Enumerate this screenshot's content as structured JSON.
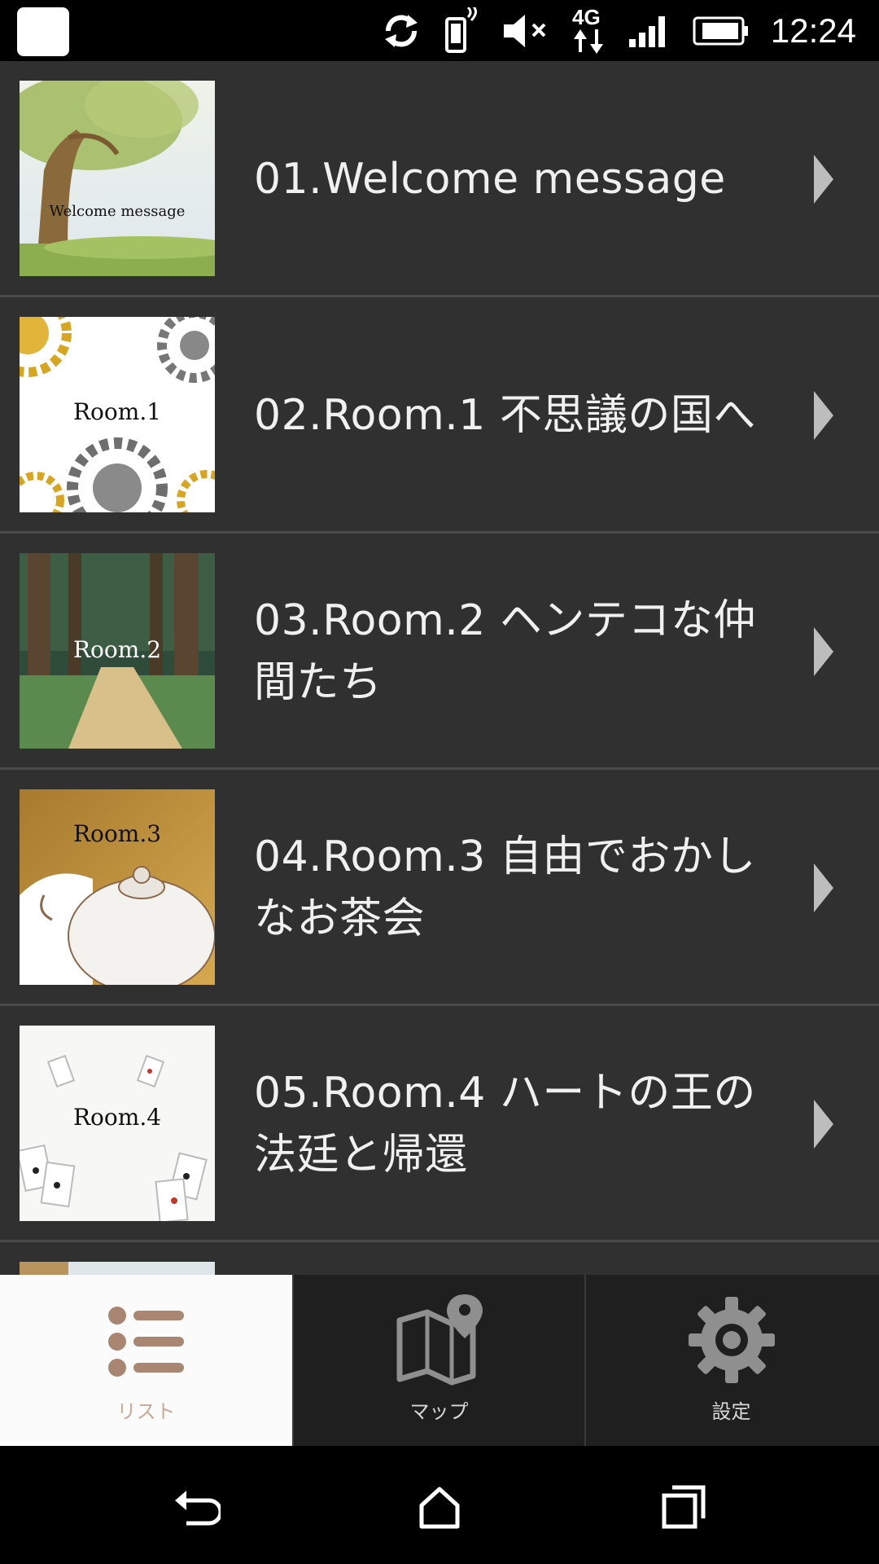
{
  "status_bar": {
    "time": "12:24",
    "icons": [
      "app-icon",
      "sync-icon",
      "vibrate-icon",
      "mute-icon",
      "4g-data-icon",
      "signal-icon",
      "battery-icon"
    ]
  },
  "list": {
    "items": [
      {
        "title_line1": "01.Welcome message",
        "title_line2": "",
        "thumb_label": "Welcome message"
      },
      {
        "title_line1": "02.Room.1 不思議の国へ",
        "title_line2": "",
        "thumb_label": "Room.1"
      },
      {
        "title_line1": "03.Room.2 ヘンテコな仲",
        "title_line2": "間たち",
        "thumb_label": "Room.2"
      },
      {
        "title_line1": "04.Room.3 自由でおかし",
        "title_line2": "なお茶会",
        "thumb_label": "Room.3"
      },
      {
        "title_line1": "05.Room.4 ハートの王の",
        "title_line2": "法廷と帰還",
        "thumb_label": "Room.4"
      }
    ]
  },
  "tabs": [
    {
      "label": "リスト",
      "icon": "list-icon",
      "active": true
    },
    {
      "label": "マップ",
      "icon": "map-icon",
      "active": false
    },
    {
      "label": "設定",
      "icon": "gear-icon",
      "active": false
    }
  ],
  "colors": {
    "list_background": "#303030",
    "accent_brown": "#a88672",
    "active_tab_bg": "#fbfbfb"
  }
}
